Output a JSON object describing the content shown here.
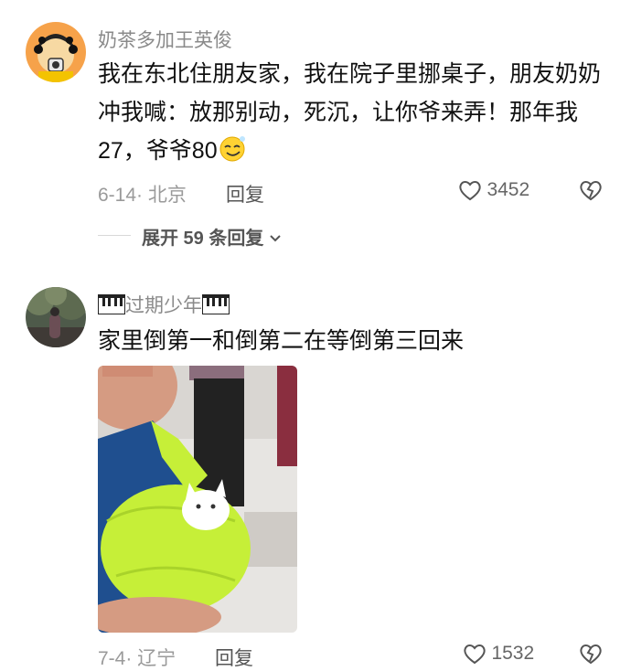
{
  "comment1": {
    "username": "奶茶多加王英俊",
    "text": "我在东北住朋友家，我在院子里挪桌子，朋友奶奶冲我喊：放那别动，死沉，让你爷来弄！那年我27，爷爷80",
    "emoji": "smirk-face",
    "date_location": "6-14· 北京",
    "reply_label": "回复",
    "like_count": "3452",
    "expand_label": "展开 59 条回复"
  },
  "comment2": {
    "username": "过期少年",
    "username_decoration": "piano-keys-icon",
    "text": "家里倒第一和倒第二在等倒第三回来",
    "image_description_icon": "photo",
    "date_location": "7-4· 辽宁",
    "reply_label": "回复",
    "like_count": "1532"
  },
  "colors": {
    "accent_avatar1": "#f5a623",
    "photo_sling": "#c6ef38",
    "muted_text": "#9a9a9a"
  }
}
